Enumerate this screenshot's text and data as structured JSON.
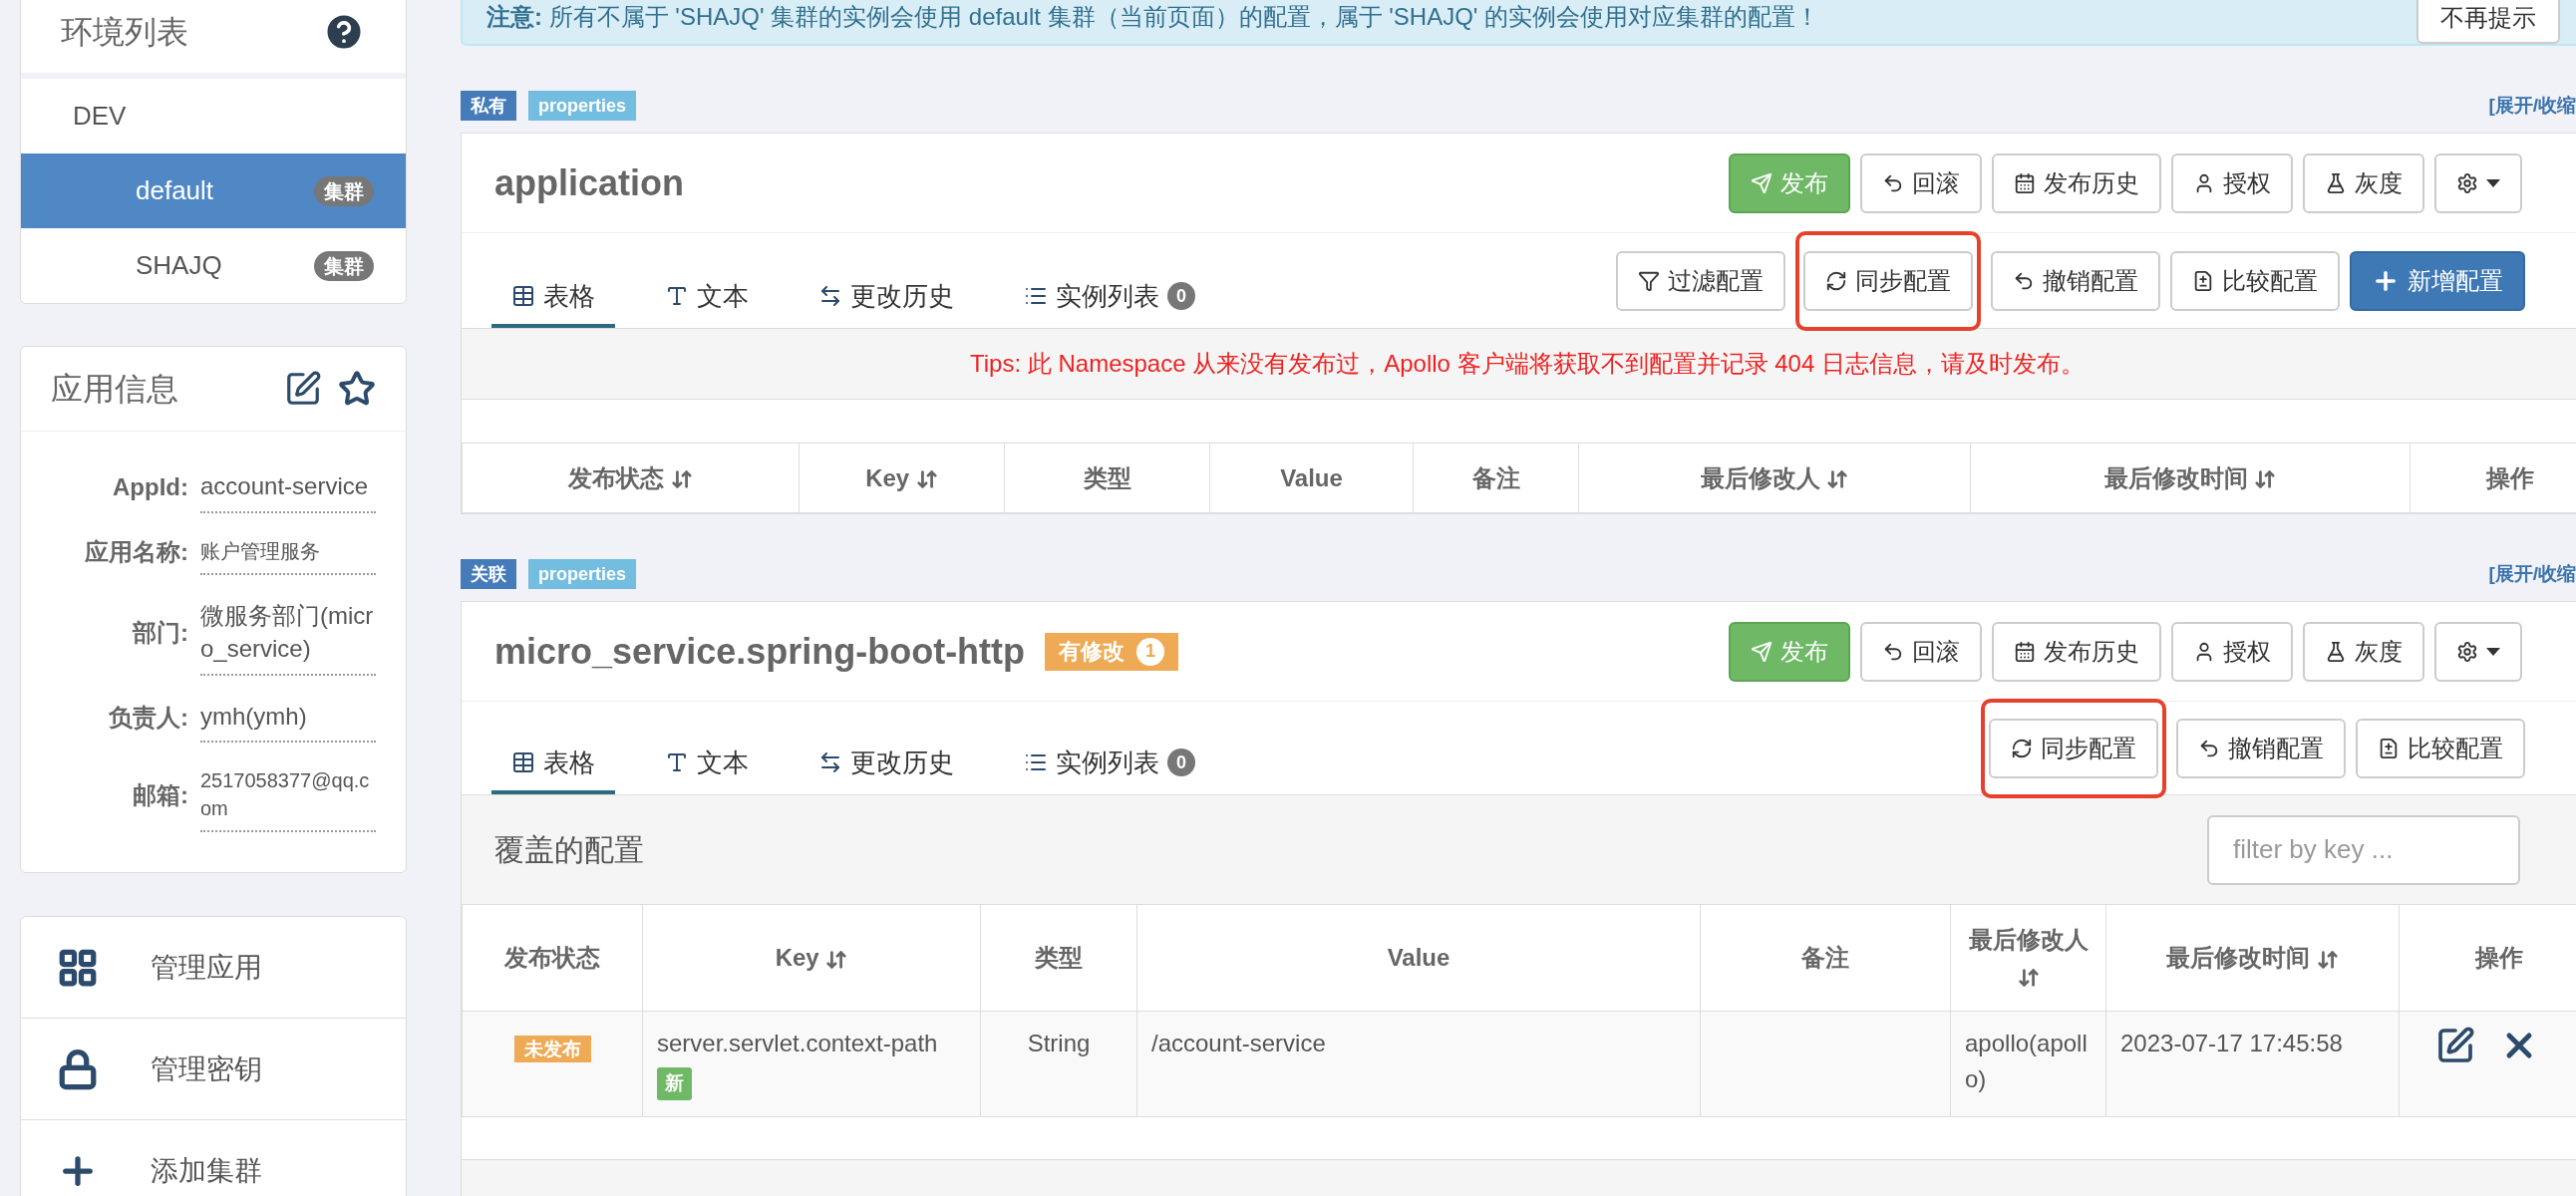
{
  "sidebar": {
    "env_panel": {
      "title": "环境列表",
      "envs": [
        {
          "name": "DEV",
          "children": [
            {
              "name": "default",
              "badge": "集群",
              "selected": true
            },
            {
              "name": "SHAJQ",
              "badge": "集群",
              "selected": false
            }
          ]
        }
      ]
    },
    "app_info": {
      "title": "应用信息",
      "fields": [
        {
          "label": "AppId:",
          "value": "account-service"
        },
        {
          "label": "应用名称:",
          "value": "账户管理服务",
          "kind": "small"
        },
        {
          "label": "部门:",
          "value": "微服务部门(micro_service)"
        },
        {
          "label": "负责人:",
          "value": "ymh(ymh)"
        },
        {
          "label": "邮箱:",
          "value": "2517058377@qq.com",
          "kind": "small"
        }
      ]
    },
    "menu": [
      {
        "label": "管理应用"
      },
      {
        "label": "管理密钥"
      },
      {
        "label": "添加集群"
      }
    ]
  },
  "alert": {
    "text": "**注意:** 所有不属于 'SHAJQ' 集群的实例会使用 default 集群（当前页面）的配置，属于 'SHAJQ' 的实例会使用对应集群的配置！",
    "dismiss": "不再提示"
  },
  "namespaces": [
    {
      "tags": [
        {
          "text": "私有",
          "kind": "scope"
        },
        {
          "text": "properties",
          "kind": "format"
        }
      ],
      "toggle": "[展开/收缩",
      "title": "application",
      "actions": [
        {
          "kind": "publish",
          "label": "发布"
        },
        {
          "kind": "rollback",
          "label": "回滚"
        },
        {
          "kind": "history",
          "label": "发布历史"
        },
        {
          "kind": "grant",
          "label": "授权"
        },
        {
          "kind": "gray",
          "label": "灰度"
        },
        {
          "kind": "settings"
        }
      ],
      "tabs": [
        {
          "label": "表格",
          "selected": true
        },
        {
          "label": "文本",
          "selected": false
        },
        {
          "label": "更改历史",
          "selected": false
        },
        {
          "label": "实例列表",
          "count": "0",
          "selected": false
        }
      ],
      "tools": [
        {
          "kind": "filter",
          "label": "过滤配置",
          "highlighted": false
        },
        {
          "kind": "sync",
          "label": "同步配置",
          "highlighted": true
        },
        {
          "kind": "revert",
          "label": "撤销配置",
          "highlighted": false
        },
        {
          "kind": "compare",
          "label": "比较配置",
          "highlighted": false
        },
        {
          "kind": "add",
          "label": "新增配置",
          "highlighted": false
        }
      ],
      "tips": "Tips: 此 Namespace 从来没有发布过，Apollo 客户端将获取不到配置并记录 404 日志信息，请及时发布。",
      "table": {
        "columns": [
          {
            "label": "发布状态",
            "sortable": true
          },
          {
            "label": "Key",
            "sortable": true
          },
          {
            "label": "类型",
            "sortable": false
          },
          {
            "label": "Value",
            "sortable": false
          },
          {
            "label": "备注",
            "sortable": false
          },
          {
            "label": "最后修改人",
            "sortable": true
          },
          {
            "label": "最后修改时间",
            "sortable": true
          },
          {
            "label": "操作",
            "sortable": false
          }
        ]
      }
    },
    {
      "tags": [
        {
          "text": "关联",
          "kind": "scope"
        },
        {
          "text": "properties",
          "kind": "format"
        }
      ],
      "toggle": "[展开/收缩",
      "title": "micro_service.spring-boot-http",
      "modified": {
        "text": "有修改",
        "count": "1"
      },
      "actions": [
        {
          "kind": "publish",
          "label": "发布"
        },
        {
          "kind": "rollback",
          "label": "回滚"
        },
        {
          "kind": "history",
          "label": "发布历史"
        },
        {
          "kind": "grant",
          "label": "授权"
        },
        {
          "kind": "gray",
          "label": "灰度"
        },
        {
          "kind": "settings"
        }
      ],
      "tabs": [
        {
          "label": "表格",
          "selected": true
        },
        {
          "label": "文本",
          "selected": false
        },
        {
          "label": "更改历史",
          "selected": false
        },
        {
          "label": "实例列表",
          "count": "0",
          "selected": false
        }
      ],
      "tools": [
        {
          "kind": "sync",
          "label": "同步配置",
          "highlighted": true
        },
        {
          "kind": "revert",
          "label": "撤销配置",
          "highlighted": false
        },
        {
          "kind": "compare",
          "label": "比较配置",
          "highlighted": false
        }
      ],
      "override": {
        "title": "覆盖的配置",
        "placeholder": "filter by key ..."
      },
      "table": {
        "columns": [
          {
            "label": "发布状态",
            "sortable": false
          },
          {
            "label": "Key",
            "sortable": true
          },
          {
            "label": "类型",
            "sortable": false
          },
          {
            "label": "Value",
            "sortable": false
          },
          {
            "label": "备注",
            "sortable": false
          },
          {
            "label": "最后修改人",
            "sortable": true
          },
          {
            "label": "最后修改时间",
            "sortable": true
          },
          {
            "label": "操作",
            "sortable": false
          }
        ],
        "rows": [
          {
            "status": "未发布",
            "key": "server.servlet.context-path",
            "key_badge": "新",
            "type": "String",
            "value": "/account-service",
            "modifier": "apollo(apollo)",
            "time": "2023-07-17 17:45:58"
          }
        ]
      }
    }
  ]
}
